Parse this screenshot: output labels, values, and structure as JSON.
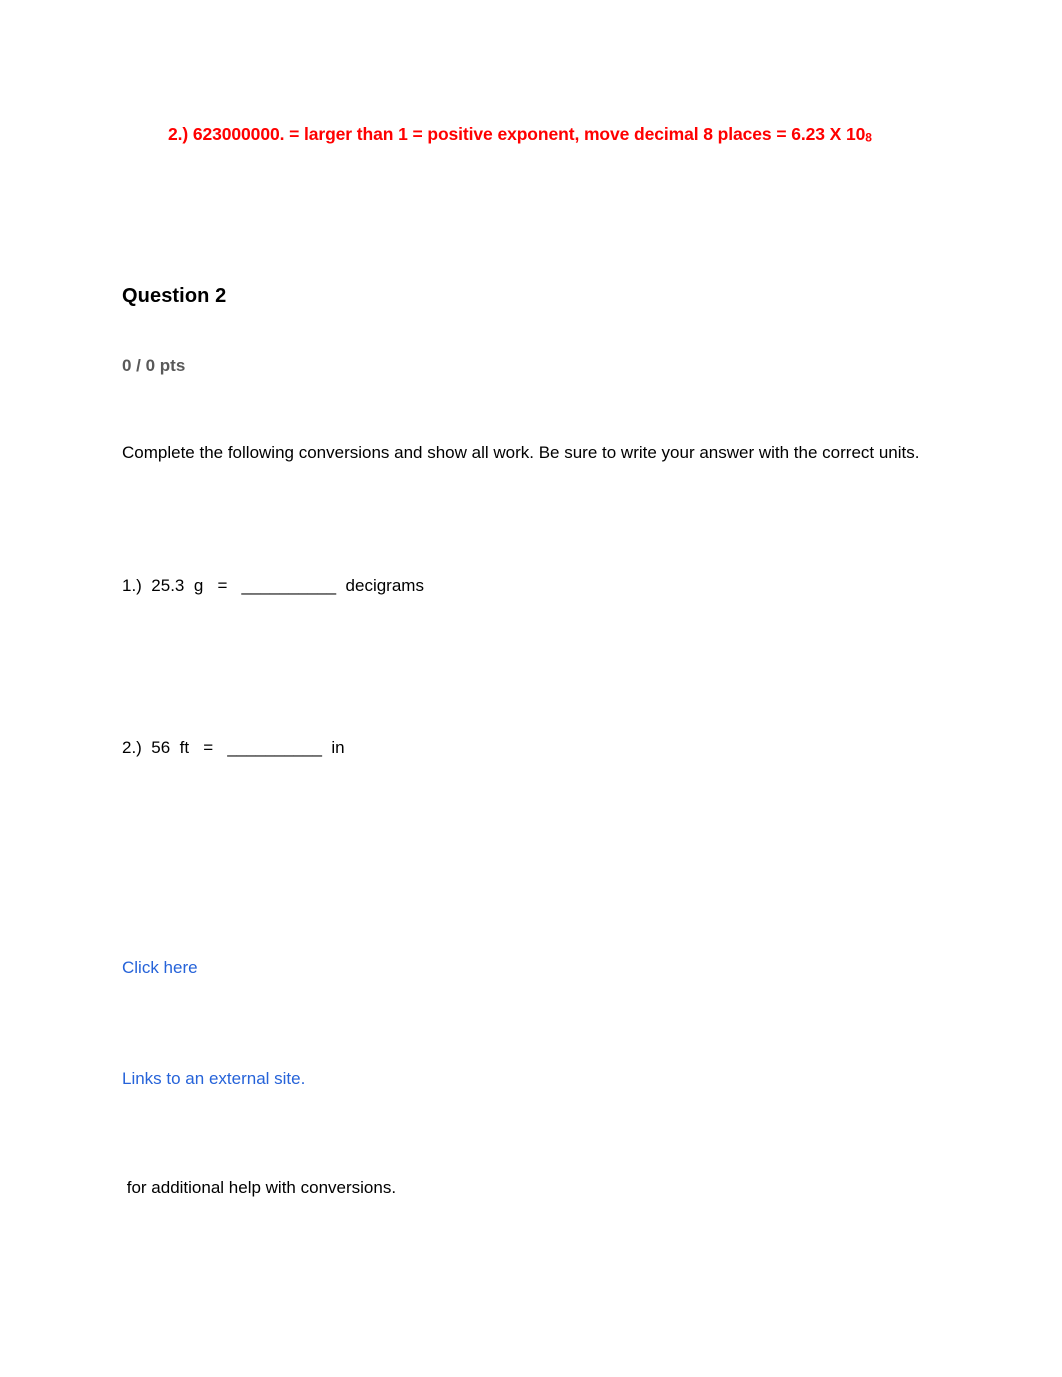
{
  "document": {
    "annotation": {
      "text": "2.) 623000000. = larger than 1 = positive exponent, move decimal 8 places = 6.23 X 10",
      "exponent": "8",
      "color": "#ff0000"
    },
    "question": {
      "heading": "Question 2",
      "points": "0 / 0 pts",
      "points_color": "#595959",
      "instructions": "Complete the following conversions and show all work. Be sure to write your answer with the correct units."
    },
    "problems": [
      {
        "number": "1.)",
        "value": "25.3",
        "unit": "g",
        "equals": "=",
        "blank": "__________",
        "target_unit": "decigrams",
        "full_text": "1.)  25.3  g   =   __________  decigrams"
      },
      {
        "number": "2.)",
        "value": "56",
        "unit": "ft",
        "equals": "=",
        "blank": "__________",
        "target_unit": "in",
        "full_text": "2.)  56  ft   =   __________  in"
      }
    ],
    "links": {
      "click_here": "Click here",
      "external_note": "Links to an external site.",
      "color": "#2663d9"
    },
    "closing_text": " for additional help with conversions."
  }
}
